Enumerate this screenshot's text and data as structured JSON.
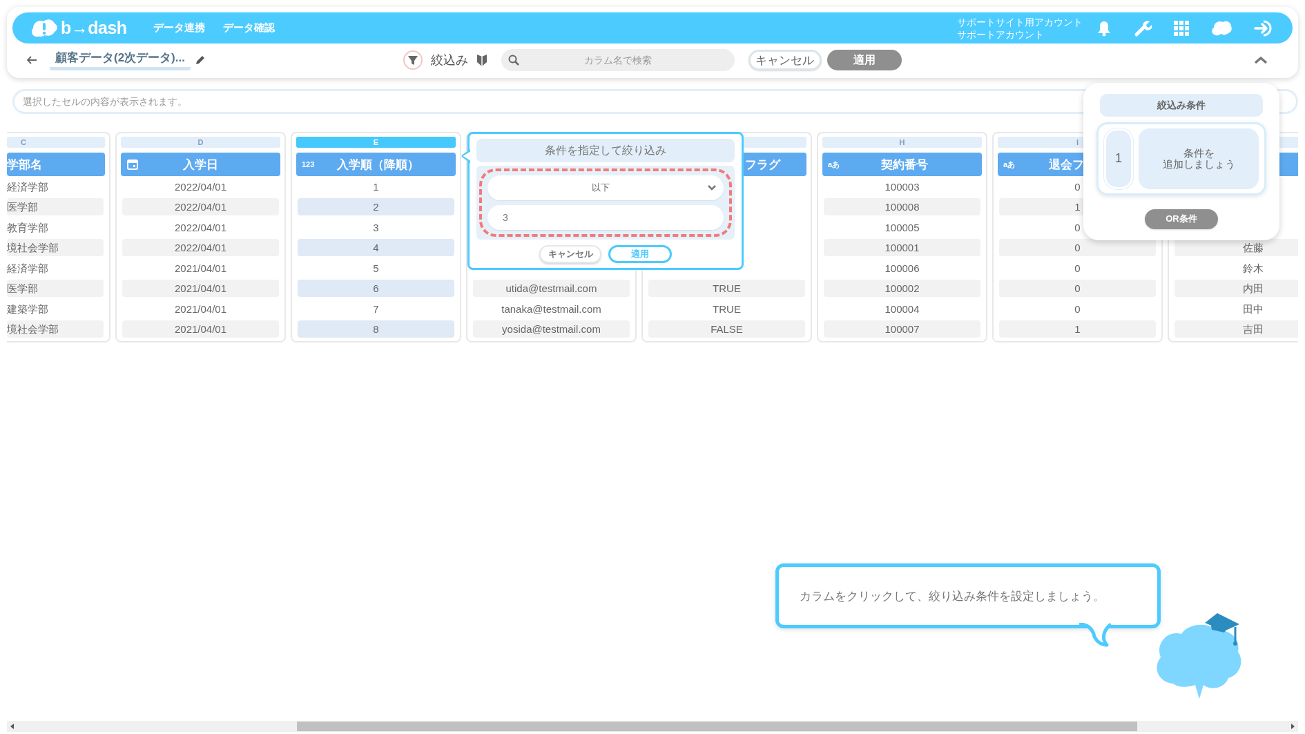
{
  "nav": {
    "logo": "b→dash",
    "links": [
      "データ連携",
      "データ確認"
    ],
    "account": {
      "site": "サポートサイト用アカウント",
      "name": "サポートアカウント"
    }
  },
  "toolbar": {
    "title": "顧客データ(2次データ)...",
    "filter_label": "絞込み",
    "search": {
      "placeholder": "カラム名で検索"
    },
    "cancel_button": {
      "label": "キャンセル",
      "disabled": false
    },
    "apply_button": {
      "label": "適用",
      "disabled": true
    }
  },
  "cell_viewer": {
    "placeholder": "選択したセルの内容が表示されます。"
  },
  "table": {
    "columns": [
      {
        "letter": "C",
        "header": "学部名",
        "kind": "text",
        "cut_off": true,
        "selected": false,
        "cells": [
          "経済学部",
          "医学部",
          "教育学部",
          "境社会学部",
          "経済学部",
          "医学部",
          "建築学部",
          "境社会学部"
        ]
      },
      {
        "letter": "D",
        "header": "入学日",
        "kind": "date",
        "selected": false,
        "cells": [
          "2022/04/01",
          "2022/04/01",
          "2022/04/01",
          "2022/04/01",
          "2021/04/01",
          "2021/04/01",
          "2021/04/01",
          "2021/04/01"
        ]
      },
      {
        "letter": "E",
        "header": "入学順（降順）",
        "kind": "number",
        "type_label": "123",
        "selected": true,
        "cells": [
          "1",
          "2",
          "3",
          "4",
          "5",
          "6",
          "7",
          "8"
        ]
      },
      {
        "kind": "text",
        "selected": false,
        "cells": [
          "utida@testmail.com",
          "tanaka@testmail.com",
          "yosida@testmail.com"
        ]
      },
      {
        "header": "フラグ",
        "kind": "text",
        "header_cut_left": true,
        "selected": false,
        "cells": [
          "TRUE",
          "TRUE",
          "FALSE"
        ]
      },
      {
        "letter": "H",
        "header": "契約番号",
        "kind": "text",
        "type_label": "aあ",
        "selected": false,
        "cells": [
          "100003",
          "100008",
          "100005",
          "100001",
          "100006",
          "100002",
          "100004",
          "100007"
        ]
      },
      {
        "letter": "I",
        "header": "退会フ",
        "kind": "text",
        "type_label": "aあ",
        "header_cut_right": true,
        "selected": false,
        "cells": [
          "0",
          "1",
          "0",
          "0",
          "0",
          "0",
          "0",
          "1"
        ]
      },
      {
        "kind": "text",
        "selected": false,
        "cells": [
          "佐藤",
          "鈴木",
          "内田",
          "田中",
          "吉田"
        ]
      }
    ]
  },
  "filter_popup": {
    "title": "条件を指定して絞り込み",
    "operator": "以下",
    "value": "3",
    "highlighted": true,
    "cancel_button": "キャンセル",
    "apply_button": "適用"
  },
  "filter_panel": {
    "title": "絞込み条件",
    "groups": [
      {
        "number": "1",
        "prompt": [
          "条件を",
          "追加しましょう"
        ]
      }
    ],
    "or_button": {
      "label": "OR条件",
      "disabled": true
    }
  },
  "guide": {
    "message": "カラムをクリックして、絞り込み条件を設定しましょう。"
  }
}
